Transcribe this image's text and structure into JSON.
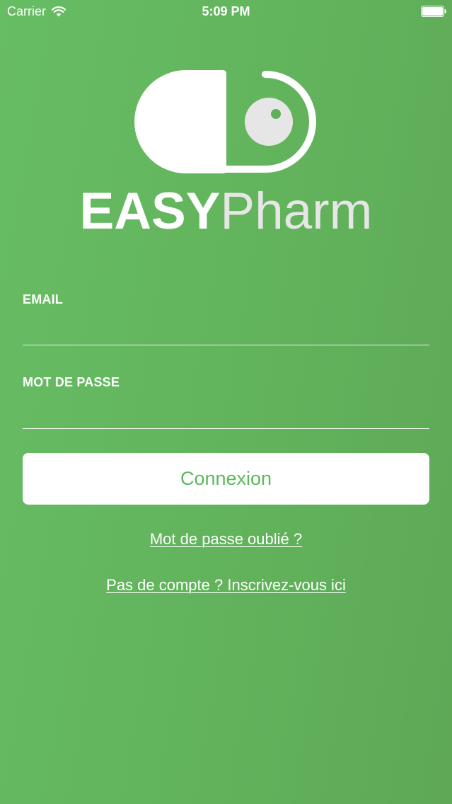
{
  "status_bar": {
    "carrier": "Carrier",
    "time": "5:09 PM",
    "wifi_icon": "wifi-icon",
    "battery_icon": "battery-icon"
  },
  "branding": {
    "logo_icon": "pill-logo-icon",
    "name_bold": "EASY",
    "name_light": "Pharm"
  },
  "form": {
    "email_label": "EMAIL",
    "email_value": "",
    "password_label": "MOT DE PASSE",
    "password_value": "",
    "submit_label": "Connexion"
  },
  "links": {
    "forgot_password": "Mot de passe oublié ?",
    "register": "Pas de compte ? Inscrivez-vous ici"
  },
  "colors": {
    "background": "#63b55d",
    "accent": "#5cb85c",
    "text": "#ffffff"
  }
}
